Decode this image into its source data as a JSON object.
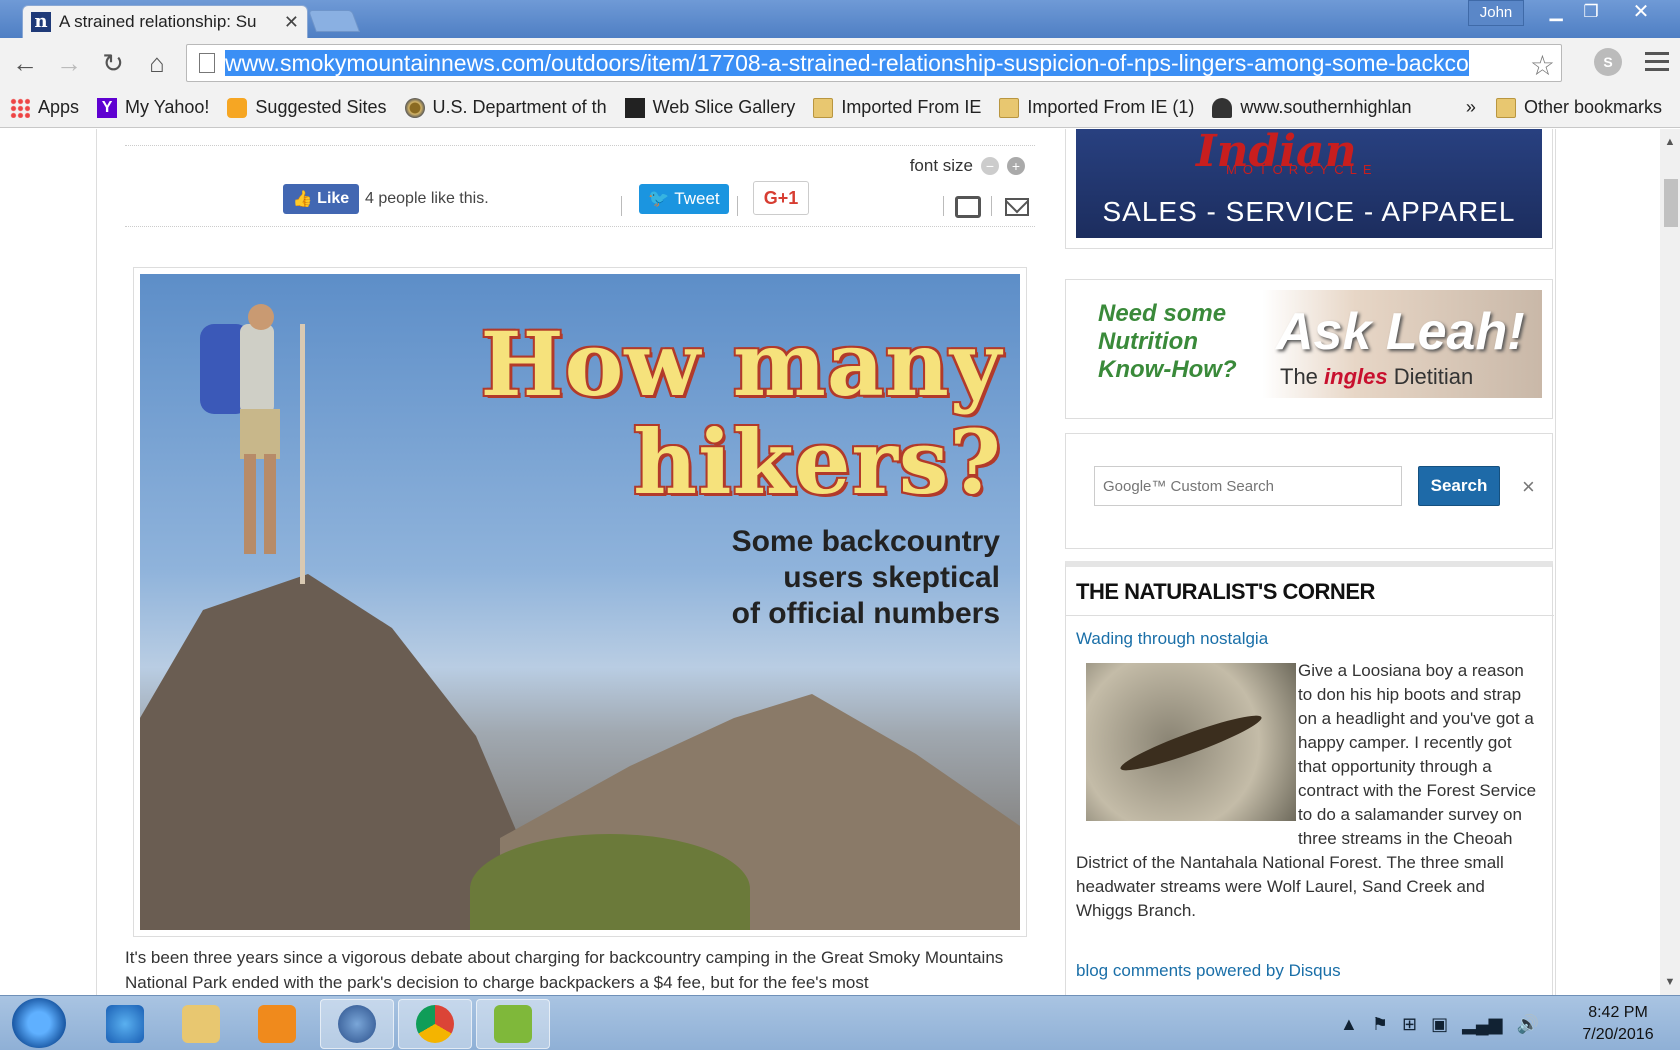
{
  "browser": {
    "tab_title": "A strained relationship: Su",
    "user": "John",
    "url_prefix": "www.smokymountainnews.com",
    "url_rest": "/outdoors/item/17708-a-strained-relationship-suspicion-of-nps-lingers-among-some-backco",
    "bookmarks": [
      {
        "label": "Apps",
        "icon": "apps-icon"
      },
      {
        "label": "My Yahoo!",
        "icon": "yahoo-icon"
      },
      {
        "label": "Suggested Sites",
        "icon": "bing-icon"
      },
      {
        "label": "U.S. Department of th",
        "icon": "seal-icon"
      },
      {
        "label": "Web Slice Gallery",
        "icon": "slice-icon"
      },
      {
        "label": "Imported From IE",
        "icon": "folder-icon"
      },
      {
        "label": "Imported From IE (1)",
        "icon": "folder-icon"
      },
      {
        "label": "www.southernhighlan",
        "icon": "hiker-icon"
      }
    ],
    "more_chevron": "»",
    "other_bookmarks": "Other bookmarks"
  },
  "share": {
    "font_size_label": "font size",
    "like_label": "Like",
    "like_text": "4 people like this.",
    "tweet_label": "Tweet",
    "gplus_label": "G+1"
  },
  "hero": {
    "headline_line1": "How many",
    "headline_line2": "hikers?",
    "sub_line1": "Some backcountry",
    "sub_line2": "users skeptical",
    "sub_line3": "of official numbers"
  },
  "article": {
    "text": "It's been three years since a vigorous debate about charging for backcountry camping in the Great Smoky Mountains National Park ended with the park's decision to charge backpackers a $4 fee, but for the fee's most"
  },
  "sidebar": {
    "ad_indian": {
      "logo": "Indian",
      "sub": "MOTORCYCLE",
      "sales": "SALES  -  SERVICE  -  APPAREL"
    },
    "ad_leah": {
      "need_line1": "Need some",
      "need_line2": "Nutrition",
      "need_line3": "Know-How?",
      "ask": "Ask Leah!",
      "tag_pre": "The",
      "tag_brand": "ingles",
      "tag_post": "Dietitian"
    },
    "search": {
      "placeholder": "Google™ Custom Search",
      "button": "Search",
      "clear": "×"
    },
    "naturalist": {
      "title": "THE NATURALIST'S CORNER",
      "link": "Wading through nostalgia",
      "text": "Give a Loosiana boy a reason to don his hip boots and strap on a headlight and you've got a happy camper. I recently got that opportunity through a contract with the Forest Service to do a salamander survey on three streams in the Cheoah District of the Nantahala National Forest. The three small headwater streams were Wolf Laurel, Sand Creek and Whiggs Branch.",
      "disqus": "blog comments powered by Disqus"
    }
  },
  "taskbar": {
    "time": "8:42 PM",
    "date": "7/20/2016"
  },
  "colors": {
    "like_blue": "#4267b2",
    "tweet_blue": "#1b95e0",
    "search_blue": "#1e6aa8",
    "link_blue": "#1a6fa8"
  }
}
